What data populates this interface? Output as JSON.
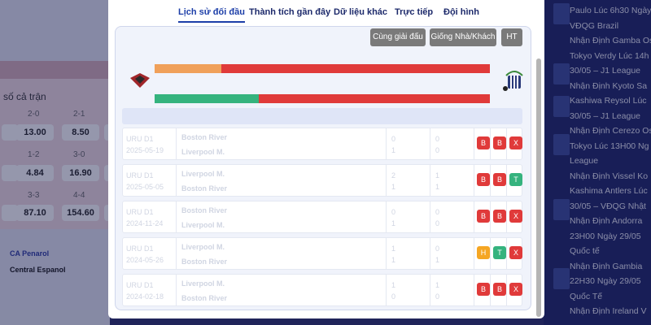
{
  "background": {
    "left": {
      "section_label": "số cả trận",
      "odds_labels": [
        "2-0",
        "2-1",
        "1-2",
        "3-0",
        "3-3",
        "4-4"
      ],
      "odds_values": [
        "13.00",
        "8.50",
        "4.84",
        "16.90",
        "87.10",
        "154.60"
      ],
      "team_a": "CA Penarol",
      "team_b": "Central Espanol"
    },
    "news": [
      "Paulo Lúc 6h30 Ngày",
      "VĐQG Brazil",
      "Nhận Định Gamba Os",
      "Tokyo Verdy Lúc 14h",
      "30/05 – J1 League",
      "Nhận Định Kyoto Sa",
      "Kashiwa Reysol Lúc",
      "30/05 – J1 League",
      "Nhận Định Cerezo Os",
      "Tokyo Lúc 13H00 Ng",
      "League",
      "Nhận Định Vissel Ko",
      "Kashima Antlers Lúc",
      "30/05 – VĐQG Nhật",
      "Nhận Định Andorra",
      "23H00 Ngày 29/05",
      "Quốc tế",
      "Nhận Định Gambia",
      "22H30 Ngày 29/05",
      "Quốc Tế",
      "Nhận Định Ireland V"
    ]
  },
  "modal": {
    "tabs": [
      "Lịch sử đối đầu",
      "Thành tích gần đây",
      "Dữ liệu khác",
      "Trực tiếp",
      "Đội hình"
    ],
    "active_tab": "Lịch sử đối đầu",
    "filters": [
      "Cùng giải đấu",
      "Giống Nhà/Khách",
      "HT"
    ],
    "bars": [
      {
        "fill": 0.2,
        "color": "#f0a05a"
      },
      {
        "fill": 0.31,
        "color": "#35b37e"
      }
    ],
    "matches": [
      {
        "league": "URU D1",
        "date": "2025-05-19",
        "home": "Boston River",
        "away": "Liverpool M.",
        "score_home": "0",
        "score_away": "1",
        "ht_home": "0",
        "ht_away": "0",
        "results": [
          "B",
          "B",
          "X"
        ]
      },
      {
        "league": "URU D1",
        "date": "2025-05-05",
        "home": "Liverpool M.",
        "away": "Boston River",
        "score_home": "2",
        "score_away": "1",
        "ht_home": "1",
        "ht_away": "1",
        "results": [
          "B",
          "B",
          "T"
        ]
      },
      {
        "league": "URU D1",
        "date": "2024-11-24",
        "home": "Boston River",
        "away": "Liverpool M.",
        "score_home": "0",
        "score_away": "1",
        "ht_home": "0",
        "ht_away": "0",
        "results": [
          "B",
          "B",
          "X"
        ]
      },
      {
        "league": "URU D1",
        "date": "2024-05-26",
        "home": "Liverpool M.",
        "away": "Boston River",
        "score_home": "1",
        "score_away": "1",
        "ht_home": "0",
        "ht_away": "1",
        "results": [
          "H",
          "T",
          "X"
        ]
      },
      {
        "league": "URU D1",
        "date": "2024-02-18",
        "home": "Liverpool M.",
        "away": "Boston River",
        "score_home": "1",
        "score_away": "0",
        "ht_home": "1",
        "ht_away": "0",
        "results": [
          "B",
          "B",
          "X"
        ]
      }
    ],
    "result_colors": {
      "B": "#e03a3a",
      "X": "#e03a3a",
      "T": "#35b37e",
      "H": "#f5a623"
    }
  }
}
